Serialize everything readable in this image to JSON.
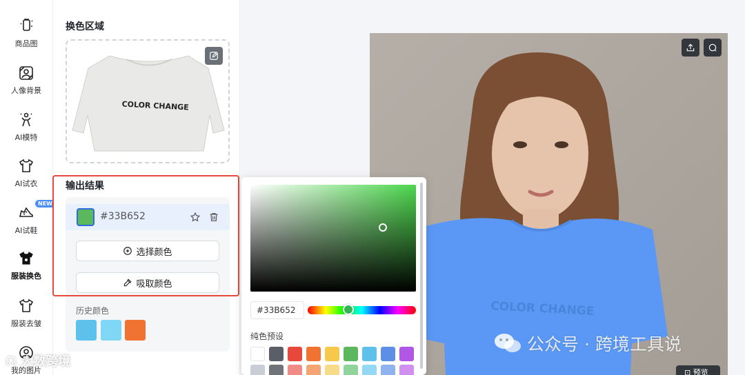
{
  "nav": {
    "items": [
      {
        "label": "商品图",
        "icon": "product-image-icon"
      },
      {
        "label": "人像背景",
        "icon": "portrait-background-icon"
      },
      {
        "label": "AI模特",
        "icon": "ai-model-icon"
      },
      {
        "label": "AI试衣",
        "icon": "ai-try-on-icon"
      },
      {
        "label": "AI试鞋",
        "icon": "ai-try-shoes-icon",
        "badge": "NEW"
      },
      {
        "label": "服装换色",
        "icon": "clothing-recolor-icon",
        "active": true
      },
      {
        "label": "服装去皱",
        "icon": "clothing-dewrinkle-icon"
      },
      {
        "label": "我的图片",
        "icon": "my-images-icon"
      }
    ]
  },
  "panel": {
    "recolor_area_title": "换色区域",
    "garment_text": "COLOR CHANGE",
    "output_title": "输出结果",
    "current_color": {
      "hex": "#33B652",
      "color": "#5cb85c"
    },
    "select_color_label": "选择颜色",
    "pick_color_label": "吸取颜色",
    "history_label": "历史颜色",
    "history_colors": [
      "#5ec1ec",
      "#7fd6f5",
      "#f07332"
    ]
  },
  "picker": {
    "hex_value": "#33B652",
    "preset_label": "纯色预设",
    "presets_row1": [
      "#ffffff",
      "#5a5e66",
      "#e8483a",
      "#f07332",
      "#f6c94b",
      "#5cb85c",
      "#5ec1ec",
      "#5d8fe6",
      "#b157e6"
    ],
    "presets_row2": [
      "#c9ced6",
      "#6f737a",
      "#f08b85",
      "#f5a574",
      "#f8db86",
      "#8fd49a",
      "#93d8f5",
      "#8fb3ef",
      "#cf90ef"
    ]
  },
  "preview": {
    "shirt_text": "COLOR CHANGE",
    "shirt_color": "#5b98f5",
    "preview_label": "预览"
  },
  "watermarks": {
    "wechat": "公众号 · 跨境工具说",
    "corner": "大数跨境"
  }
}
